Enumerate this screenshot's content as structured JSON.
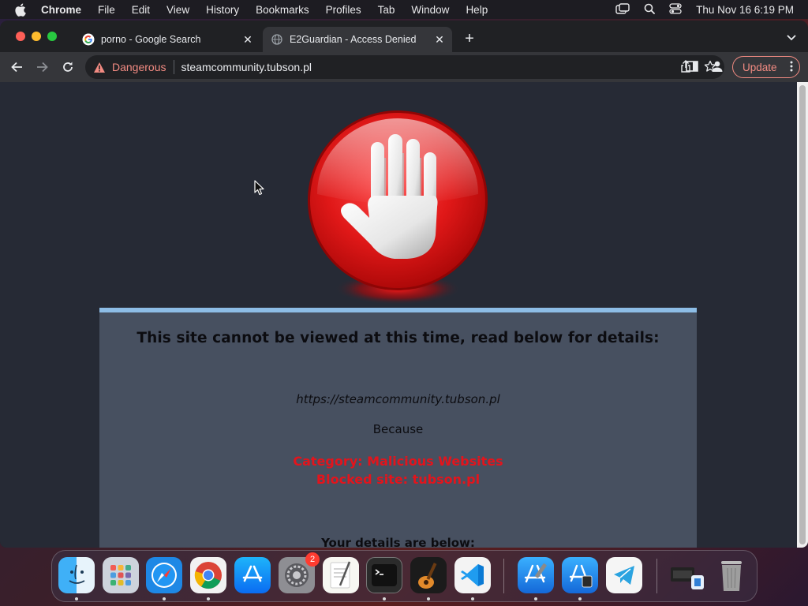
{
  "menubar": {
    "app_name": "Chrome",
    "items": [
      "File",
      "Edit",
      "View",
      "History",
      "Bookmarks",
      "Profiles",
      "Tab",
      "Window",
      "Help"
    ],
    "clock": "Thu Nov 16  6:19 PM"
  },
  "browser": {
    "tabs": [
      {
        "title": "porno - Google Search",
        "icon": "google-icon",
        "active": false
      },
      {
        "title": "E2Guardian - Access Denied",
        "icon": "globe-icon",
        "active": true
      }
    ],
    "security_label": "Dangerous",
    "url": "steamcommunity.tubson.pl",
    "update_label": "Update"
  },
  "page": {
    "headline": "This site cannot be viewed at this time, read below for details:",
    "blocked_url": "https://steamcommunity.tubson.pl",
    "because": "Because",
    "reason_category": "Category: Malicious Websites",
    "reason_blocked": "Blocked site: tubson.pl",
    "details_heading": "Your details are below:"
  },
  "dock": {
    "apps": [
      "Finder",
      "Launchpad",
      "Safari",
      "Google Chrome",
      "App Store",
      "System Settings",
      "TextEdit",
      "Terminal",
      "GarageBand",
      "Visual Studio Code",
      "Xcode",
      "Simulator",
      "Telegram",
      "Downloads",
      "Trash"
    ],
    "system_settings_badge": "2"
  },
  "colors": {
    "danger_text": "#f28b82",
    "reason_red": "#e3141c",
    "panel_bg": "#475060",
    "panel_top_border": "#8dbde6",
    "page_bg": "#262a35"
  }
}
